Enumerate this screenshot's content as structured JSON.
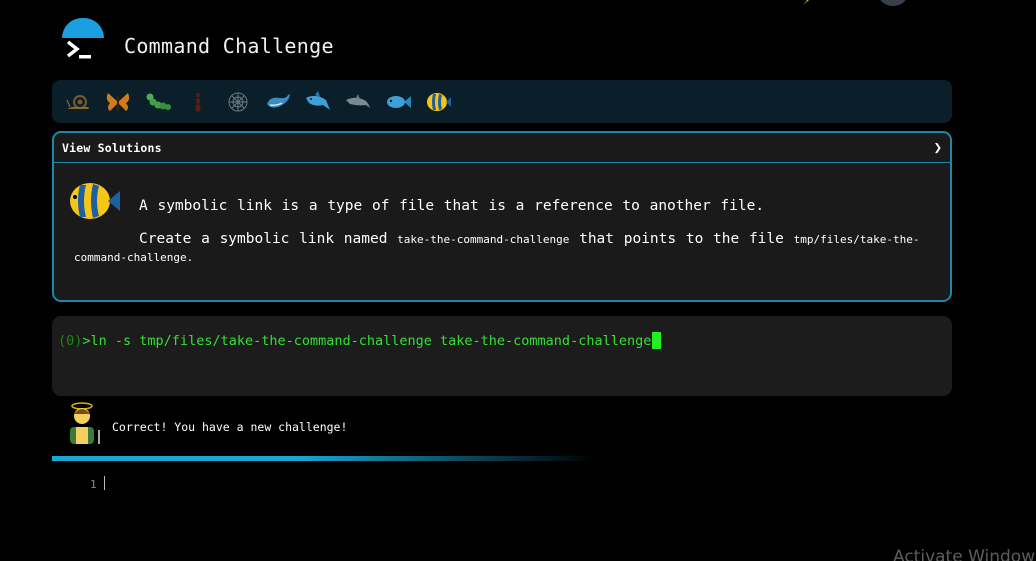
{
  "header": {
    "title": "Command Challenge"
  },
  "levels": [
    {
      "name": "snail-icon"
    },
    {
      "name": "butterfly-icon"
    },
    {
      "name": "caterpillar-icon"
    },
    {
      "name": "ant-icon"
    },
    {
      "name": "spider-web-icon"
    },
    {
      "name": "whale-icon"
    },
    {
      "name": "shark-icon"
    },
    {
      "name": "dolphin-icon"
    },
    {
      "name": "fish-icon"
    },
    {
      "name": "tropical-fish-icon"
    }
  ],
  "challenge": {
    "header_label": "View Solutions",
    "line1": "A symbolic link is a type of file that is a reference to another file.",
    "line2_prefix": "Create a symbolic link named ",
    "line2_code": "take-the-command-challenge",
    "line2_mid": " that points to the file ",
    "line2_code2": "tmp/files/take-the-",
    "line3": "command-challenge."
  },
  "terminal": {
    "exit_code": "(0)",
    "prompt": ">",
    "command": " ln -s tmp/files/take-the-command-challenge take-the-command-challenge"
  },
  "feedback": {
    "message": "Correct! You have a new challenge!"
  },
  "editor": {
    "line_number": "1"
  },
  "watermark": "Activate Windows",
  "colors": {
    "accent": "#1aa7d4",
    "terminal_text": "#33e033",
    "card_border": "#1c88a8"
  }
}
